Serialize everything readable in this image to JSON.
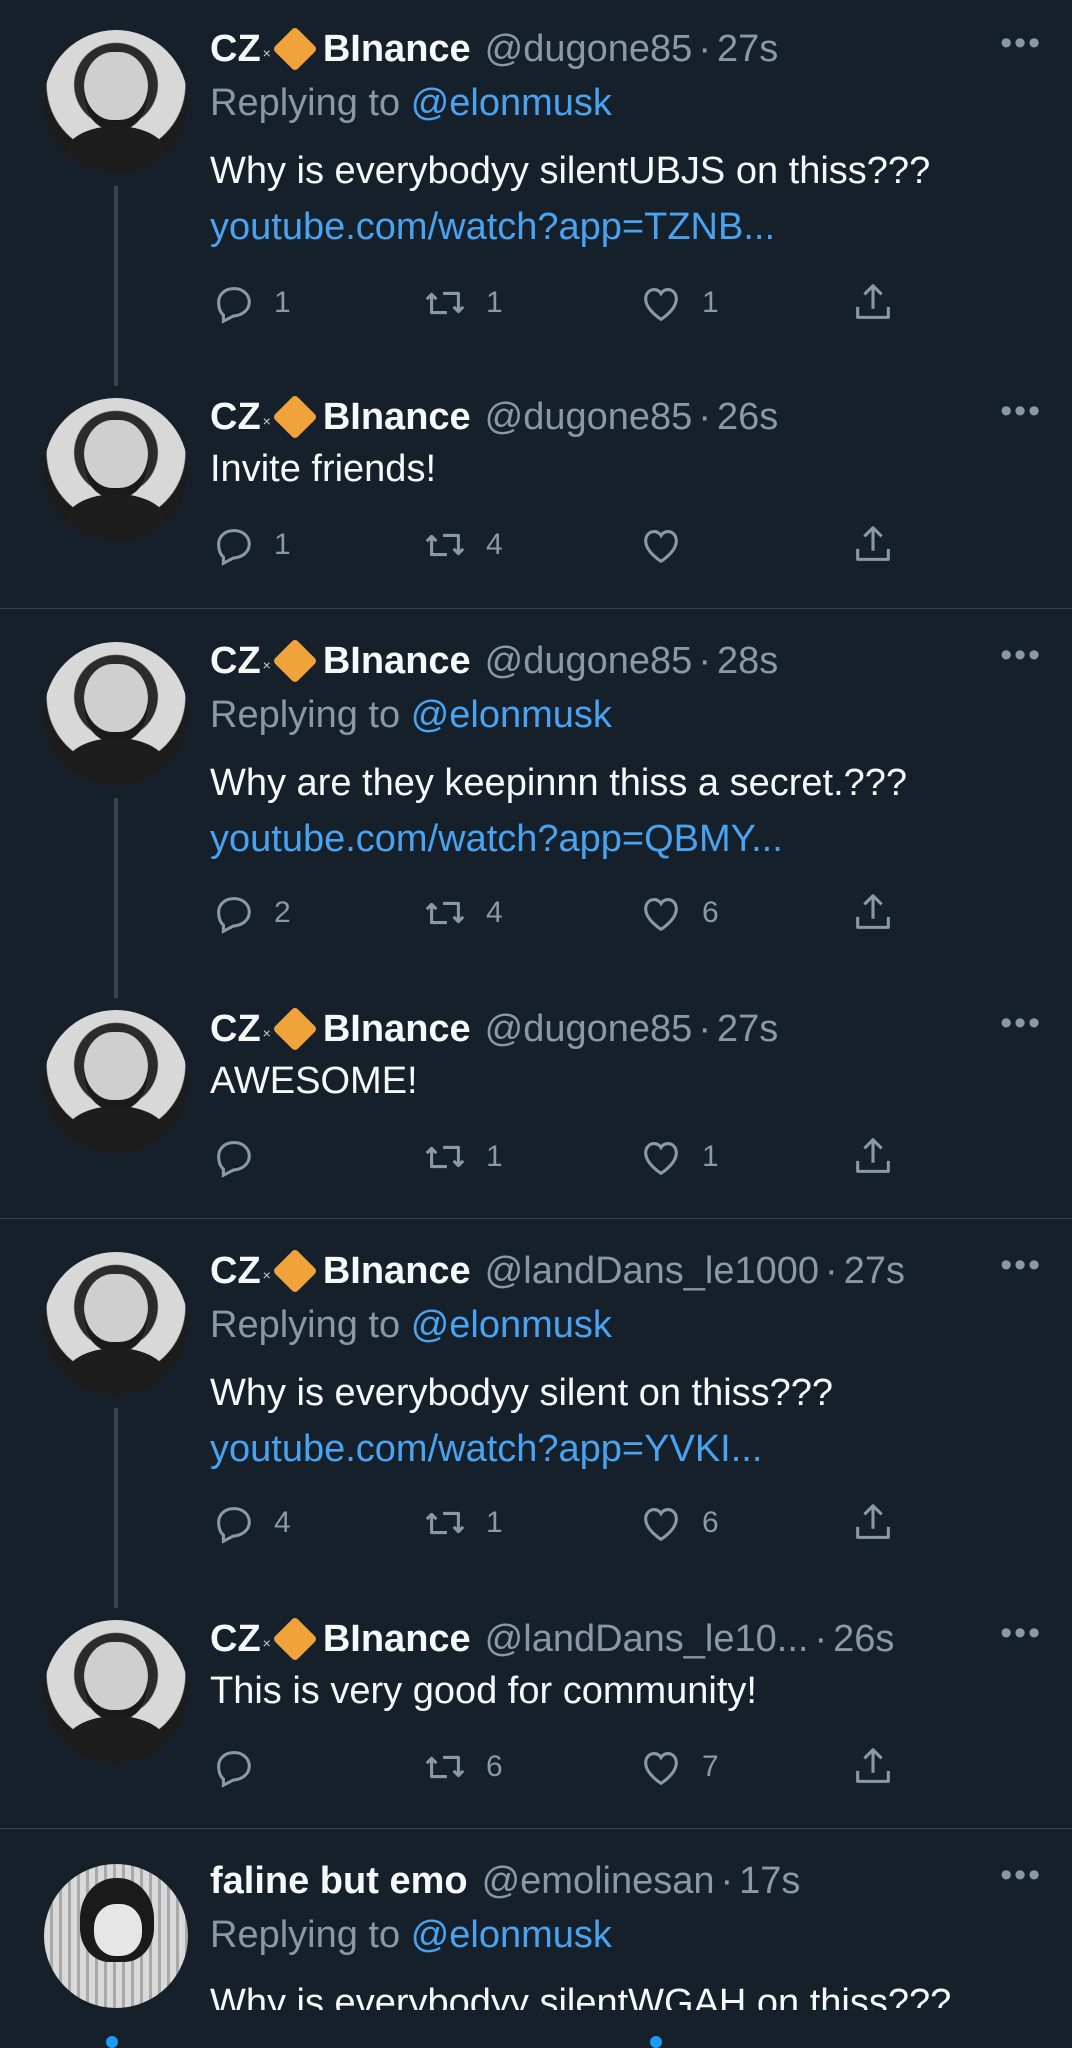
{
  "tweets": [
    {
      "name": "CZ",
      "brand": "BInance",
      "handle": "@dugone85",
      "time": "27s",
      "reply_prefix": "Replying to",
      "reply_to": "@elonmusk",
      "text": "Why is everybodyy silentUBJS on thiss???",
      "link": "youtube.com/watch?app=TZNB...",
      "replies": "1",
      "retweets": "1",
      "likes": "1",
      "more": "•••"
    },
    {
      "name": "CZ",
      "brand": "BInance",
      "handle": "@dugone85",
      "time": "26s",
      "text": "Invite friends!",
      "replies": "1",
      "retweets": "4",
      "likes": "",
      "more": "•••"
    },
    {
      "name": "CZ",
      "brand": "BInance",
      "handle": "@dugone85",
      "time": "28s",
      "reply_prefix": "Replying to",
      "reply_to": "@elonmusk",
      "text": "Why are they keepinnn thiss a secret.???",
      "link": "youtube.com/watch?app=QBMY...",
      "replies": "2",
      "retweets": "4",
      "likes": "6",
      "more": "•••"
    },
    {
      "name": "CZ",
      "brand": "BInance",
      "handle": "@dugone85",
      "time": "27s",
      "text": "AWESOME!",
      "replies": "",
      "retweets": "1",
      "likes": "1",
      "more": "•••"
    },
    {
      "name": "CZ",
      "brand": "BInance",
      "handle": "@landDans_le1000",
      "time": "27s",
      "reply_prefix": "Replying to",
      "reply_to": "@elonmusk",
      "text": "Why is everybodyy silent on thiss???",
      "link": "youtube.com/watch?app=YVKI...",
      "replies": "4",
      "retweets": "1",
      "likes": "6",
      "more": "•••"
    },
    {
      "name": "CZ",
      "brand": "BInance",
      "handle": "@landDans_le10...",
      "time": "26s",
      "text": "This is very good for community!",
      "replies": "",
      "retweets": "6",
      "likes": "7",
      "more": "•••"
    },
    {
      "name": "faline but emo",
      "brand": "",
      "handle": "@emolinesan",
      "time": "17s",
      "reply_prefix": "Replying to",
      "reply_to": "@elonmusk",
      "text": "Why is everybodyy silentWGAH on thiss???",
      "more": "•••"
    }
  ],
  "separator_dot": "·"
}
